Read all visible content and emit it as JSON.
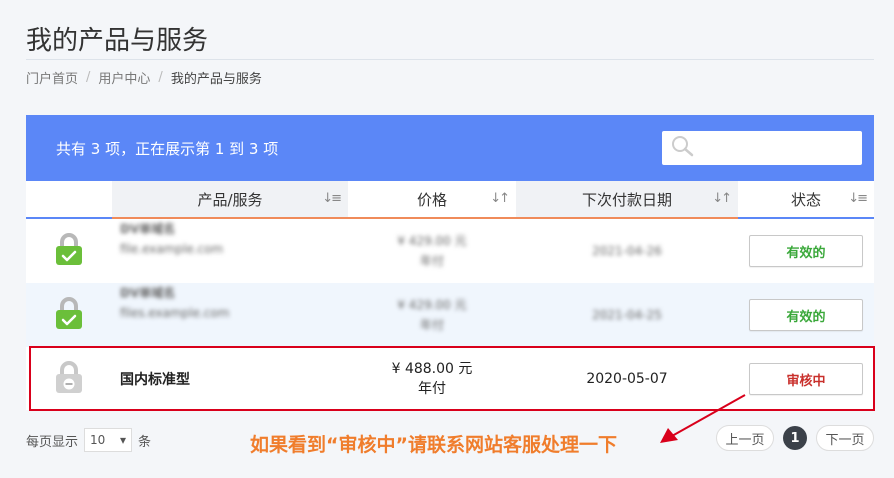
{
  "page": {
    "title": "我的产品与服务",
    "breadcrumb": [
      "门户首页",
      "用户中心",
      "我的产品与服务"
    ],
    "breadcrumb_sep": "/"
  },
  "table": {
    "summary": "共有 3 项，正在展示第 1 到 3 项",
    "search_placeholder": "",
    "columns": [
      "产品/服务",
      "价格",
      "下次付款日期",
      "状态"
    ],
    "sort_icons": [
      "↓≡",
      "↓↑",
      "↓↑",
      "↓≡"
    ],
    "rows": [
      {
        "name": "DV单域名",
        "domain": "file.example.com",
        "price": "¥ 429.00 元",
        "cycle": "年付",
        "date": "2021-04-26",
        "status": "有效的",
        "icon": "lock-check-icon"
      },
      {
        "name": "DV单域名",
        "domain": "files.example.com",
        "price": "¥ 429.00 元",
        "cycle": "年付",
        "date": "2021-04-25",
        "status": "有效的",
        "icon": "lock-check-icon"
      },
      {
        "name": "国内标准型",
        "domain": "",
        "price": "¥ 488.00 元",
        "cycle": "年付",
        "date": "2020-05-07",
        "status": "审核中",
        "icon": "lock-pending-icon"
      }
    ]
  },
  "footer": {
    "page_size_label": "每页显示",
    "page_size_value": "10",
    "page_size_unit": "条",
    "prev": "上一页",
    "current_page": "1",
    "next": "下一页"
  },
  "annotation": {
    "note": "如果看到“审核中”请联系网站客服处理一下"
  },
  "colors": {
    "header_blue": "#5b87f7",
    "active_green": "#3aa83a",
    "pending_red": "#c9302c",
    "note_orange": "#f07d2c",
    "highlight_red": "#d9001b"
  }
}
